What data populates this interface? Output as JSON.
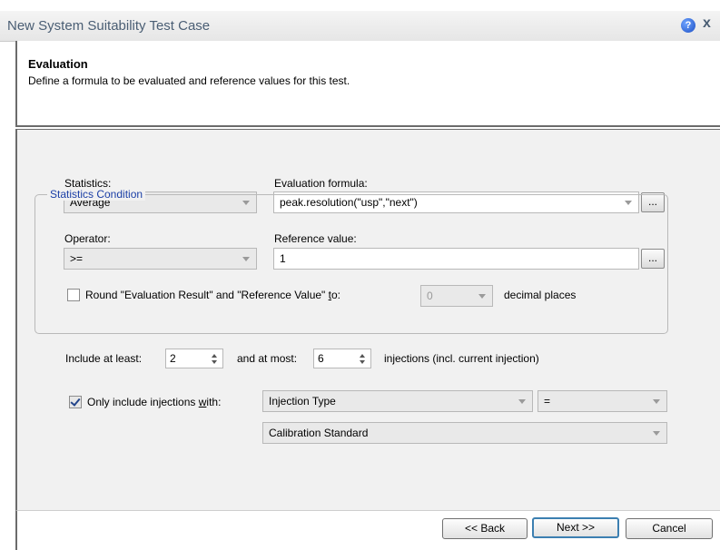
{
  "window": {
    "title": "New System Suitability Test Case",
    "help_icon": "?",
    "close_icon": "x"
  },
  "header": {
    "heading": "Evaluation",
    "description": "Define a formula to be evaluated and reference values for this test."
  },
  "form": {
    "statistics": {
      "label": "Statistics:",
      "value": "Average"
    },
    "evaluation_formula": {
      "label": "Evaluation formula:",
      "value": "peak.resolution(\"usp\",\"next\")",
      "browse_label": "..."
    },
    "operator": {
      "label": "Operator:",
      "value": ">="
    },
    "reference_value": {
      "label": "Reference value:",
      "value": "1",
      "browse_label": "..."
    },
    "round": {
      "label_prefix": "Round \"Evaluation Result\" and \"Reference Value\" ",
      "label_underlined": "t",
      "label_suffix": "o:",
      "checked": false,
      "value": "0",
      "suffix": "decimal places"
    }
  },
  "statistics_condition": {
    "legend": "Statistics Condition",
    "include_at_least_label": "Include at least:",
    "min_value": "2",
    "and_at_most_label": "and at most:",
    "max_value": "6",
    "injections_suffix": "injections (incl. current injection)",
    "only_include": {
      "label_prefix": "Only include injections ",
      "label_underlined": "w",
      "label_suffix": "ith:",
      "checked": true,
      "field_value": "Injection Type",
      "operator_value": "=",
      "value": "Calibration Standard"
    }
  },
  "buttons": {
    "back": "<< Back",
    "next": "Next >>",
    "cancel": "Cancel"
  }
}
